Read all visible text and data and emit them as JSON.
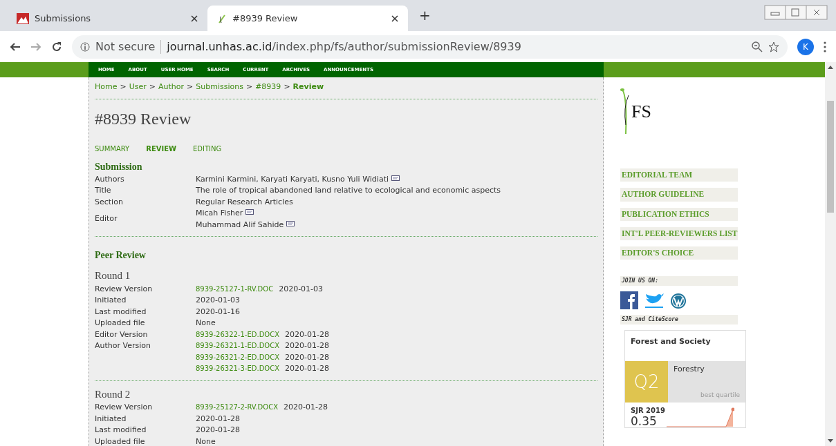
{
  "browser": {
    "tabs": [
      {
        "title": "Submissions",
        "selected": false
      },
      {
        "title": "#8939 Review",
        "selected": true
      }
    ],
    "new_tab": "+",
    "security": "Not secure",
    "url_domain": "journal.unhas.ac.id",
    "url_path": "/index.php/fs/author/submissionReview/8939",
    "profile": "K"
  },
  "nav": [
    "HOME",
    "ABOUT",
    "USER HOME",
    "SEARCH",
    "CURRENT",
    "ARCHIVES",
    "ANNOUNCEMENTS"
  ],
  "breadcrumb": [
    {
      "label": "Home",
      "current": false
    },
    {
      "sep": ">",
      "label": "User",
      "current": false
    },
    {
      "sep": ">",
      "label": "Author",
      "current": false
    },
    {
      "sep": ">",
      "label": "Submissions",
      "current": false
    },
    {
      "sep": ">",
      "label": "#8939",
      "current": false
    },
    {
      "sep": ">",
      "label": "Review",
      "current": true
    }
  ],
  "page_title": "#8939 Review",
  "subtabs": [
    {
      "label": "SUMMARY",
      "selected": false
    },
    {
      "label": "REVIEW",
      "selected": true
    },
    {
      "label": "EDITING",
      "selected": false
    }
  ],
  "submission": {
    "heading": "Submission",
    "rows": [
      {
        "label": "Authors",
        "values": [
          {
            "text": "Karmini Karmini, Karyati Karyati, Kusno Yuli Widiati",
            "mail": true
          }
        ]
      },
      {
        "label": "Title",
        "values": [
          {
            "text": "The role of tropical abandoned land relative to ecological and economic aspects",
            "mail": false
          }
        ]
      },
      {
        "label": "Section",
        "values": [
          {
            "text": "Regular Research Articles",
            "mail": false
          }
        ]
      },
      {
        "label": "Editor",
        "values": [
          {
            "text": "Micah Fisher",
            "mail": true
          },
          {
            "text": "Muhammad Alif Sahide",
            "mail": true
          }
        ]
      }
    ]
  },
  "peer_review": {
    "heading": "Peer Review",
    "rounds": [
      {
        "title": "Round 1",
        "rows": [
          {
            "label": "Review Version",
            "values": [
              {
                "file": "8939-25127-1-RV.DOC",
                "date": "2020-01-03"
              }
            ]
          },
          {
            "label": "Initiated",
            "values": [
              {
                "text": "2020-01-03"
              }
            ]
          },
          {
            "label": "Last modified",
            "values": [
              {
                "text": "2020-01-16"
              }
            ]
          },
          {
            "label": "Uploaded file",
            "values": [
              {
                "text": "None"
              }
            ]
          },
          {
            "label": "Editor Version",
            "values": [
              {
                "file": "8939-26322-1-ED.DOCX",
                "date": "2020-01-28"
              }
            ]
          },
          {
            "label": "Author Version",
            "values": [
              {
                "file": "8939-26321-1-ED.DOCX",
                "date": "2020-01-28"
              },
              {
                "file": "8939-26321-2-ED.DOCX",
                "date": "2020-01-28"
              },
              {
                "file": "8939-26321-3-ED.DOCX",
                "date": "2020-01-28"
              }
            ]
          }
        ]
      },
      {
        "title": "Round 2",
        "rows": [
          {
            "label": "Review Version",
            "values": [
              {
                "file": "8939-25127-2-RV.DOCX",
                "date": "2020-01-28"
              }
            ]
          },
          {
            "label": "Initiated",
            "values": [
              {
                "text": "2020-01-28"
              }
            ]
          },
          {
            "label": "Last modified",
            "values": [
              {
                "text": "2020-01-28"
              }
            ]
          },
          {
            "label": "Uploaded file",
            "values": [
              {
                "text": "None"
              }
            ]
          }
        ]
      }
    ]
  },
  "sidebar": {
    "logo": "FS",
    "links": [
      "EDITORIAL TEAM",
      "AUTHOR GUIDELINE",
      "PUBLICATION ETHICS",
      "INT'L PEER-REVIEWERS LIST",
      "EDITOR'S CHOICE"
    ],
    "join_heading": "JOIN US ON:",
    "sjr_heading": "SJR and CiteScore",
    "widget": {
      "journal": "Forest and Society",
      "quartile": "Q2",
      "category": "Forestry",
      "quartile_note": "best quartile",
      "metric": "SJR 2019",
      "value": "0.35"
    }
  }
}
